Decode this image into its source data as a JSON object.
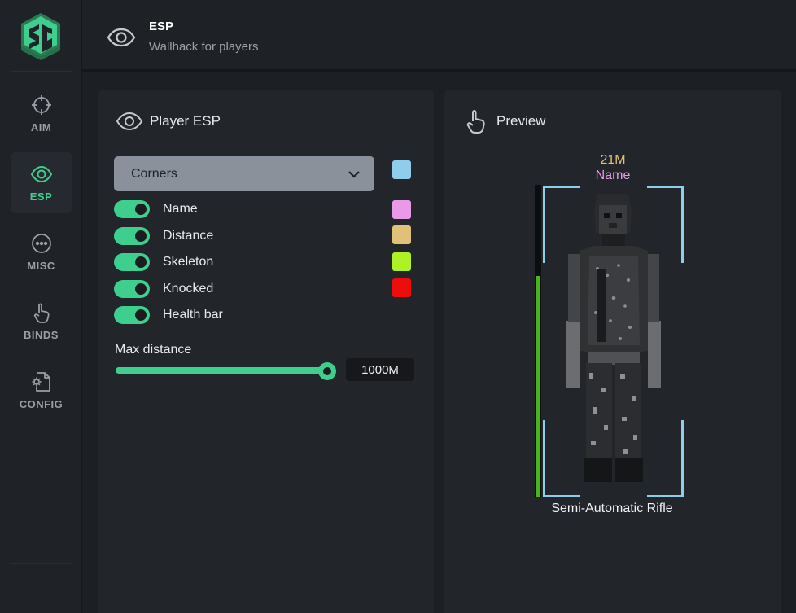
{
  "app": {
    "logo_text": "SG"
  },
  "sidebar": {
    "items": [
      {
        "label": "AIM",
        "icon": "crosshair-icon",
        "active": false
      },
      {
        "label": "ESP",
        "icon": "eye-icon",
        "active": true
      },
      {
        "label": "MISC",
        "icon": "dots-circle-icon",
        "active": false
      },
      {
        "label": "BINDS",
        "icon": "pointer-hand-icon",
        "active": false
      },
      {
        "label": "CONFIG",
        "icon": "config-file-icon",
        "active": false
      }
    ]
  },
  "header": {
    "title": "ESP",
    "subtitle": "Wallhack for players",
    "icon": "eye-icon"
  },
  "player_esp": {
    "title": "Player ESP",
    "box_style": {
      "value": "Corners",
      "color": "#8fcdea"
    },
    "toggles": [
      {
        "label": "Name",
        "enabled": true,
        "color": "#e99ae6"
      },
      {
        "label": "Distance",
        "enabled": true,
        "color": "#e1c078"
      },
      {
        "label": "Skeleton",
        "enabled": true,
        "color": "#aef226"
      },
      {
        "label": "Knocked",
        "enabled": true,
        "color": "#ee0d0d"
      },
      {
        "label": "Health bar",
        "enabled": true,
        "color": null
      }
    ],
    "max_distance": {
      "label": "Max distance",
      "value": "1000M",
      "fraction": 1.0
    }
  },
  "preview": {
    "title": "Preview",
    "distance": "21M",
    "name": "Name",
    "weapon": "Semi-Automatic Rifle",
    "health_fraction": 0.71
  },
  "colors": {
    "accent": "#3ecf8e",
    "background": "#1c1f24",
    "panel": "#22252a"
  }
}
